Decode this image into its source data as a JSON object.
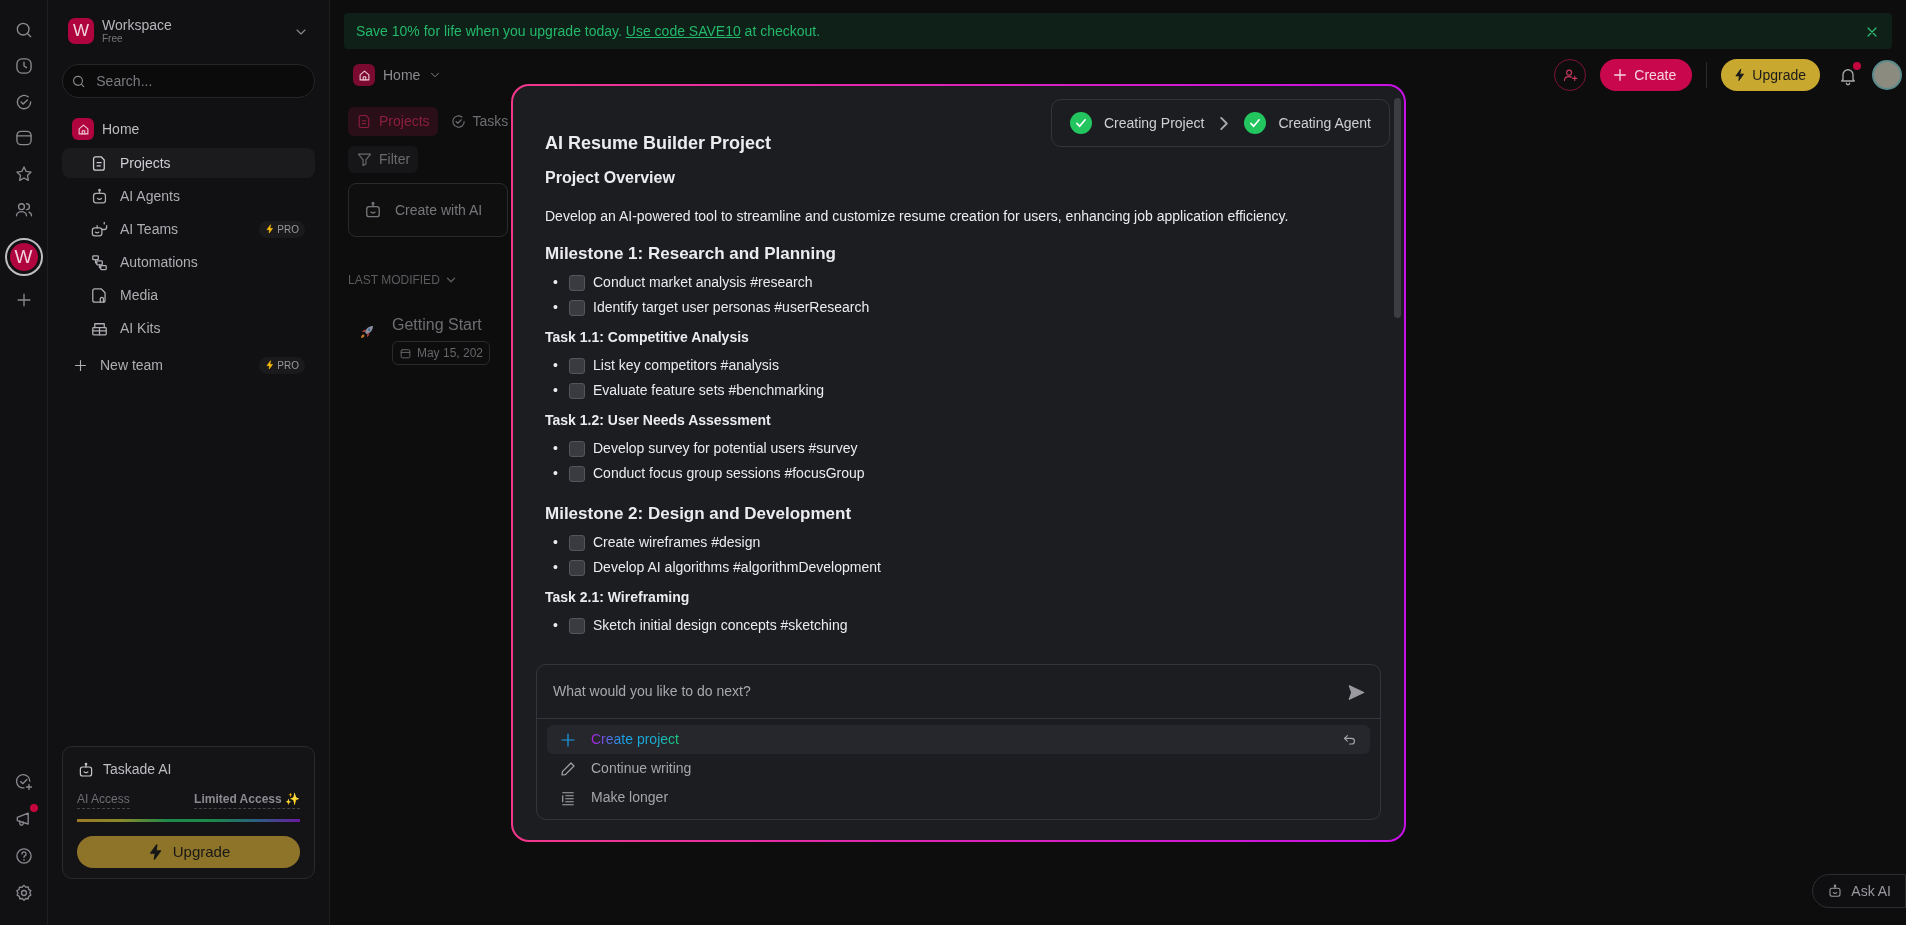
{
  "banner": {
    "before": "Save 10% for life when you upgrade today.",
    "link": "Use code SAVE10",
    "after": "at checkout."
  },
  "rail": {
    "top": [
      {
        "kind": "search",
        "selected": false
      },
      {
        "kind": "clock",
        "selected": false
      },
      {
        "kind": "check",
        "selected": false
      },
      {
        "kind": "calendar",
        "selected": false
      },
      {
        "kind": "star",
        "selected": false
      },
      {
        "kind": "people",
        "selected": false
      },
      {
        "kind": "workspace",
        "label": "W",
        "selected": true
      },
      {
        "kind": "add",
        "selected": false
      }
    ],
    "bottom": [
      {
        "kind": "task-add",
        "notification": false
      },
      {
        "kind": "megaphone",
        "notification": true
      },
      {
        "kind": "help",
        "notification": false
      },
      {
        "kind": "settings",
        "notification": false
      }
    ]
  },
  "workspace": {
    "avatar": "W",
    "name": "Workspace",
    "plan": "Free"
  },
  "search": {
    "placeholder": "Search..."
  },
  "nav": [
    {
      "label": "Home",
      "children": [
        {
          "label": "Projects",
          "selected": true
        },
        {
          "label": "AI Agents",
          "selected": false
        },
        {
          "label": "AI Teams",
          "selected": false,
          "badge": "PRO"
        },
        {
          "label": "Automations",
          "selected": false
        },
        {
          "label": "Media",
          "selected": false
        },
        {
          "label": "AI Kits",
          "selected": false
        }
      ]
    }
  ],
  "new_team": {
    "label": "New team",
    "badge": "PRO"
  },
  "ai_card": {
    "title": "Taskade AI",
    "access_label": "AI Access",
    "access_value": "Limited Access ✨",
    "level": 1,
    "button": "Upgrade"
  },
  "header": {
    "breadcrumb": "Home",
    "create": "Create",
    "upgrade": "Upgrade",
    "notification": true
  },
  "tabs": [
    {
      "label": "Projects",
      "selected": true
    },
    {
      "label": "Tasks",
      "selected": false
    }
  ],
  "filter": "Filter",
  "create_card": "Create with AI",
  "sort": "LAST MODIFIED",
  "projects": [
    {
      "title": "Getting Start",
      "date": "May 15, 202"
    }
  ],
  "modal": {
    "steps": [
      {
        "label": "Creating Project",
        "done": true
      },
      {
        "label": "Creating Agent",
        "done": true
      }
    ],
    "title": "AI Resume Builder Project",
    "blocks": [
      {
        "kind": "h2",
        "text": "Project Overview"
      },
      {
        "kind": "p",
        "text": "Develop an AI-powered tool to streamline and customize resume creation for users, enhancing job application efficiency."
      },
      {
        "kind": "h3",
        "text": "Milestone 1: Research and Planning"
      },
      {
        "kind": "tasks",
        "items": [
          {
            "bullet": "•",
            "text": "Conduct market analysis #research",
            "checked": false
          },
          {
            "bullet": "•",
            "text": "Identify target user personas #userResearch",
            "checked": false
          }
        ]
      },
      {
        "kind": "h4",
        "text": "Task 1.1: Competitive Analysis"
      },
      {
        "kind": "tasks",
        "items": [
          {
            "bullet": "•",
            "text": "List key competitors #analysis",
            "checked": false
          },
          {
            "bullet": "•",
            "text": "Evaluate feature sets #benchmarking",
            "checked": false
          }
        ]
      },
      {
        "kind": "h4",
        "text": "Task 1.2: User Needs Assessment"
      },
      {
        "kind": "tasks",
        "items": [
          {
            "bullet": "•",
            "text": "Develop survey for potential users #survey",
            "checked": false
          },
          {
            "bullet": "•",
            "text": "Conduct focus group sessions #focusGroup",
            "checked": false
          }
        ]
      },
      {
        "kind": "h3",
        "text": "Milestone 2: Design and Development"
      },
      {
        "kind": "tasks",
        "items": [
          {
            "bullet": "•",
            "text": "Create wireframes #design",
            "checked": false
          },
          {
            "bullet": "•",
            "text": "Develop AI algorithms #algorithmDevelopment",
            "checked": false
          }
        ]
      },
      {
        "kind": "h4",
        "text": "Task 2.1: Wireframing"
      },
      {
        "kind": "tasks",
        "items": [
          {
            "bullet": "•",
            "text": "Sketch initial design concepts #sketching",
            "checked": false
          }
        ]
      }
    ],
    "composer": {
      "placeholder": "What would you like to do next?",
      "suggestions": [
        {
          "label": "Create project",
          "selected": true
        },
        {
          "label": "Continue writing",
          "selected": false
        },
        {
          "label": "Make longer",
          "selected": false
        }
      ]
    }
  },
  "ask_ai": "Ask AI"
}
